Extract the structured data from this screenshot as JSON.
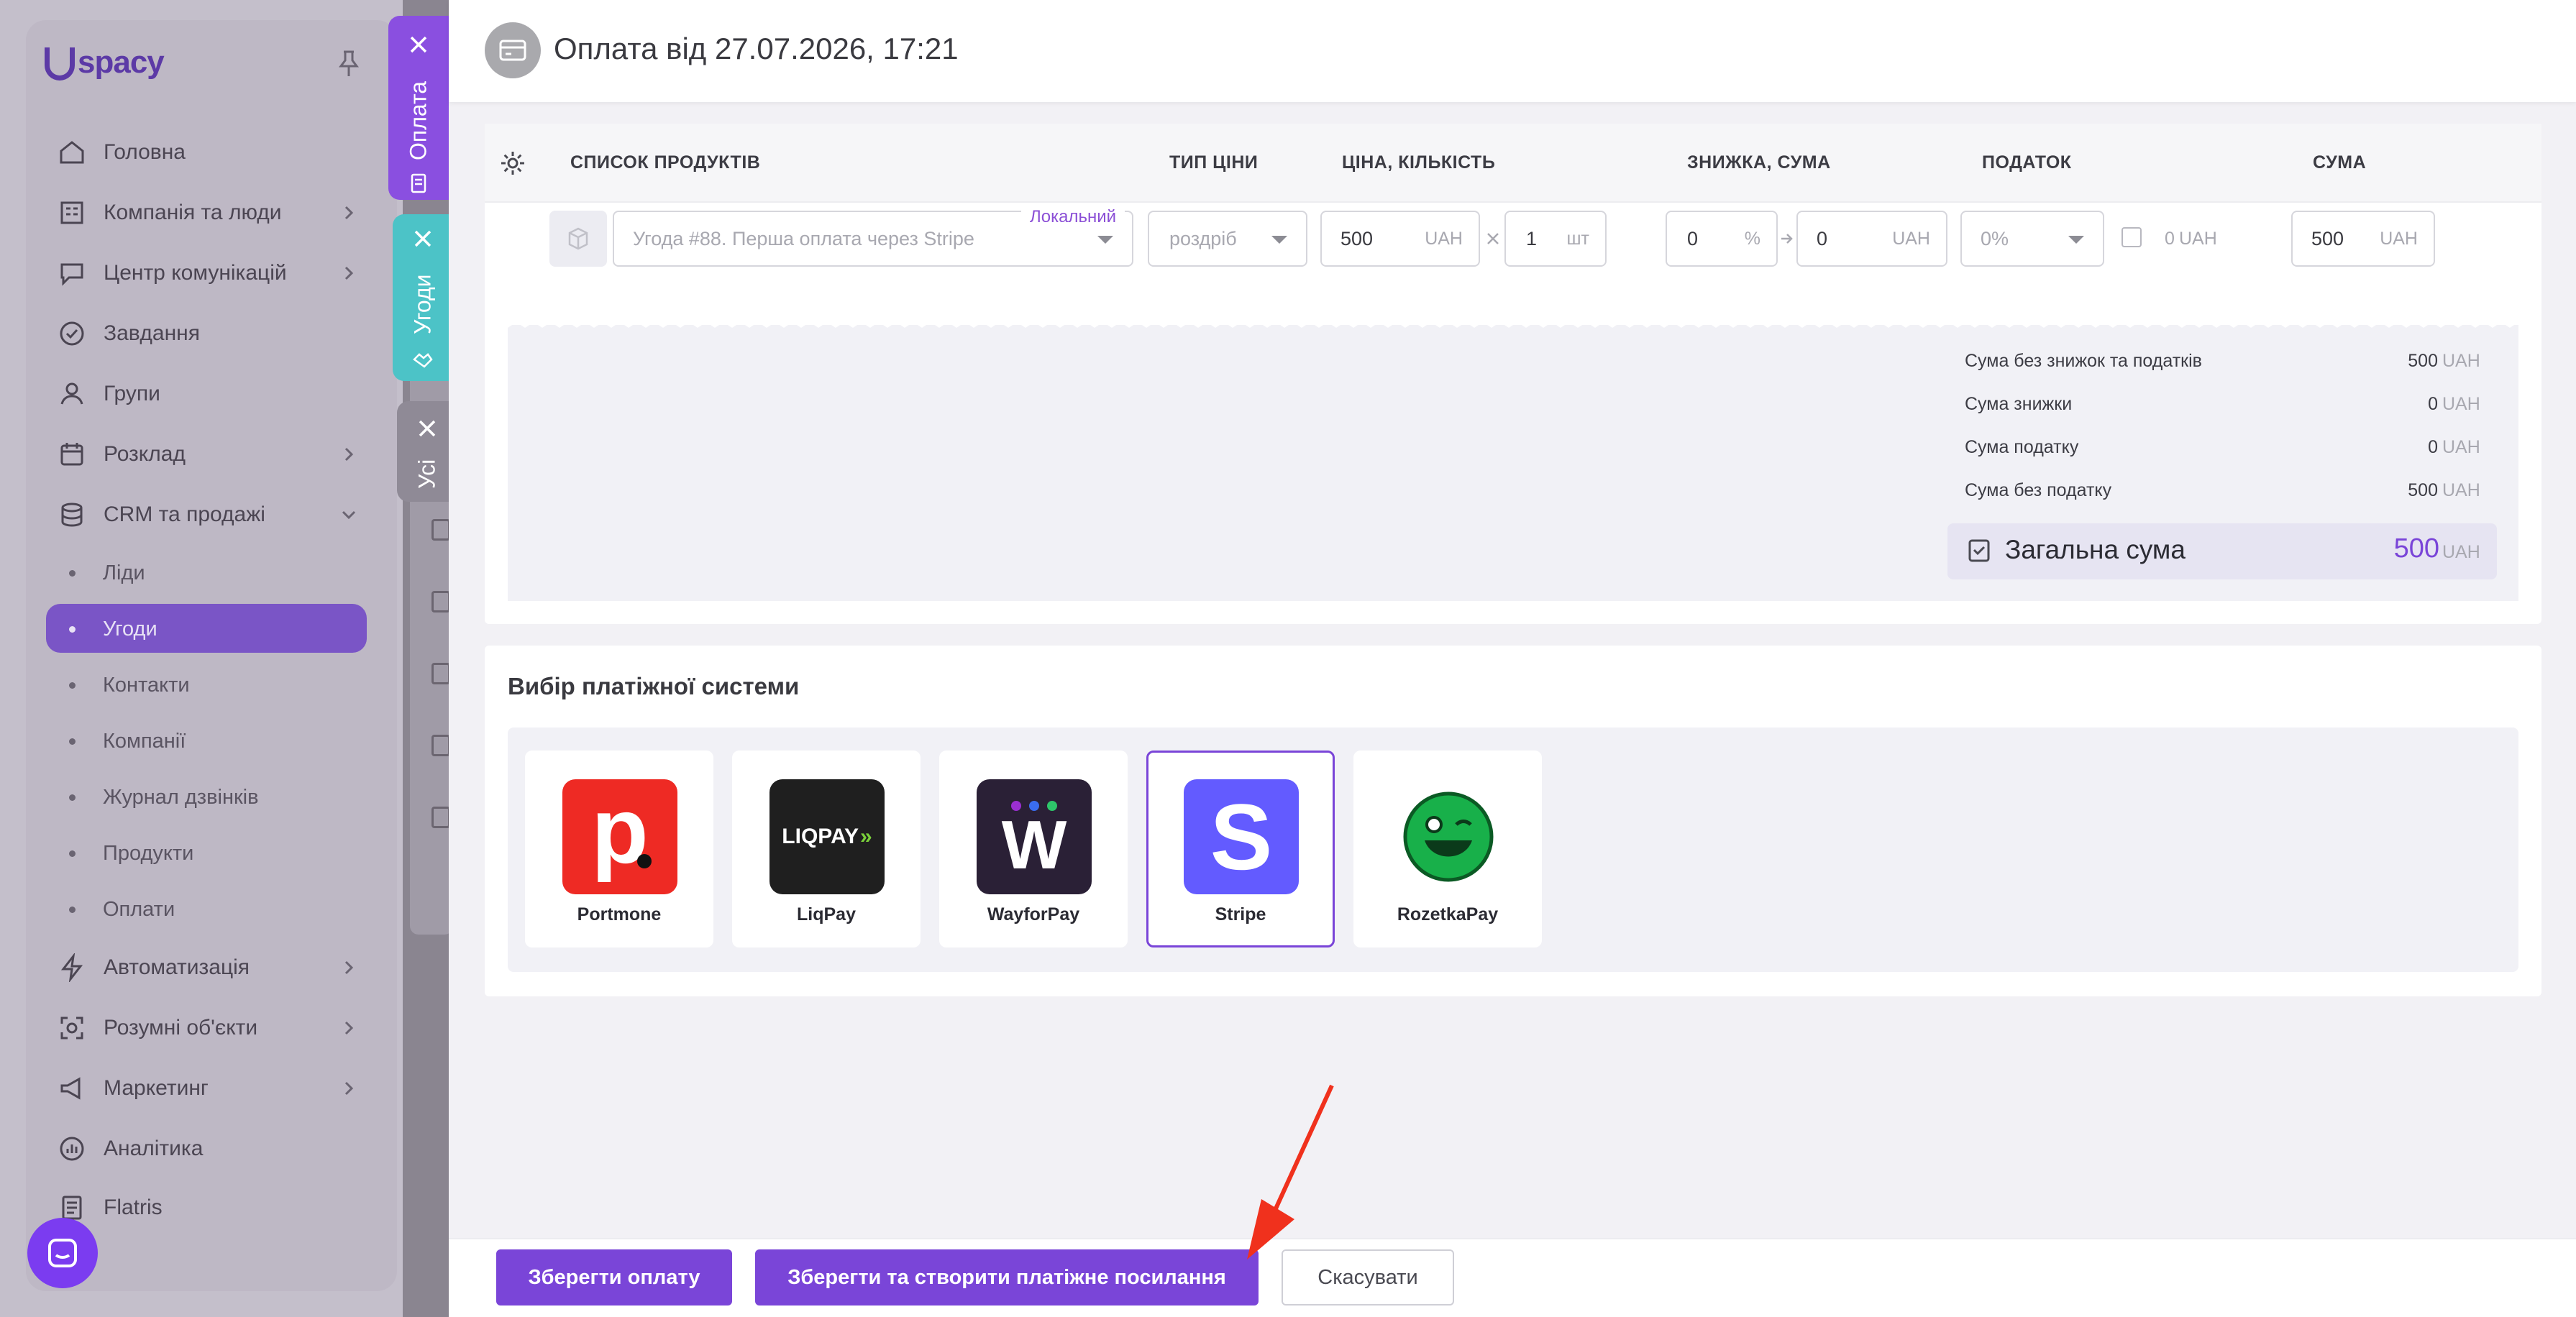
{
  "sidebar": {
    "logo": "spacy",
    "items": [
      {
        "label": "Головна"
      },
      {
        "label": "Компанія та люди"
      },
      {
        "label": "Центр комунікацій"
      },
      {
        "label": "Завдання"
      },
      {
        "label": "Групи"
      },
      {
        "label": "Розклад"
      },
      {
        "label": "CRM та продажі"
      }
    ],
    "crm_sub": [
      {
        "label": "Ліди"
      },
      {
        "label": "Угоди"
      },
      {
        "label": "Контакти"
      },
      {
        "label": "Компанії"
      },
      {
        "label": "Журнал дзвінків"
      },
      {
        "label": "Продукти"
      },
      {
        "label": "Оплати"
      }
    ],
    "items_bottom": [
      {
        "label": "Автоматизація"
      },
      {
        "label": "Розумні об'єкти"
      },
      {
        "label": "Маркетинг"
      },
      {
        "label": "Аналітика"
      },
      {
        "label": "Flatris"
      }
    ]
  },
  "vertical_tabs": [
    {
      "label": "Оплата"
    },
    {
      "label": "Угоди"
    },
    {
      "label": "Усі"
    }
  ],
  "header": {
    "title": "Оплата від 27.07.2026, 17:21"
  },
  "table": {
    "headers": {
      "products": "СПИСОК ПРОДУКТІВ",
      "price_type": "ТИП ЦІНИ",
      "price_qty": "ЦІНА, КІЛЬКІСТЬ",
      "discount": "ЗНИЖКА, СУМА",
      "tax": "ПОДАТОК",
      "sum": "СУМА"
    },
    "row": {
      "product_placeholder": "Угода #88. Перша оплата через Stripe",
      "local_badge": "Локальний",
      "price_type": "роздріб",
      "price": "500",
      "price_unit": "UAH",
      "qty": "1",
      "qty_unit": "шт",
      "discount_percent": "0",
      "percent_sign": "%",
      "discount_sum": "0",
      "discount_unit": "UAH",
      "tax": "0%",
      "tax_sum": "0",
      "tax_unit": "UAH",
      "sum": "500",
      "sum_unit": "UAH"
    }
  },
  "summary": {
    "rows": [
      {
        "label": "Сума без знижок та податків",
        "value": "500",
        "unit": "UAH"
      },
      {
        "label": "Сума знижки",
        "value": "0",
        "unit": "UAH"
      },
      {
        "label": "Сума податку",
        "value": "0",
        "unit": "UAH"
      },
      {
        "label": "Сума без податку",
        "value": "500",
        "unit": "UAH"
      }
    ],
    "total_label": "Загальна сума",
    "total_value": "500",
    "total_unit": "UAH"
  },
  "payment": {
    "title": "Вибір платіжної системи",
    "systems": [
      {
        "name": "Portmone",
        "logo_text": "p",
        "selected": false
      },
      {
        "name": "LiqPay",
        "logo_text": "LIQPAY",
        "selected": false
      },
      {
        "name": "WayforPay",
        "logo_text": "W",
        "selected": false
      },
      {
        "name": "Stripe",
        "logo_text": "S",
        "selected": true
      },
      {
        "name": "RozetkaPay",
        "logo_text": "",
        "selected": false
      }
    ]
  },
  "footer": {
    "save": "Зберегти оплату",
    "save_link": "Зберегти та створити платіжне посилання",
    "cancel": "Скасувати"
  },
  "colors": {
    "accent": "#7a45d8",
    "teal_tab": "#4cc3c7",
    "portmone": "#ee2a24",
    "liqpay": "#1f1f1f",
    "wayforpay": "#2a2036",
    "stripe": "#635bff",
    "rozetka": "#18b04a",
    "arrow": "#f0311d"
  }
}
